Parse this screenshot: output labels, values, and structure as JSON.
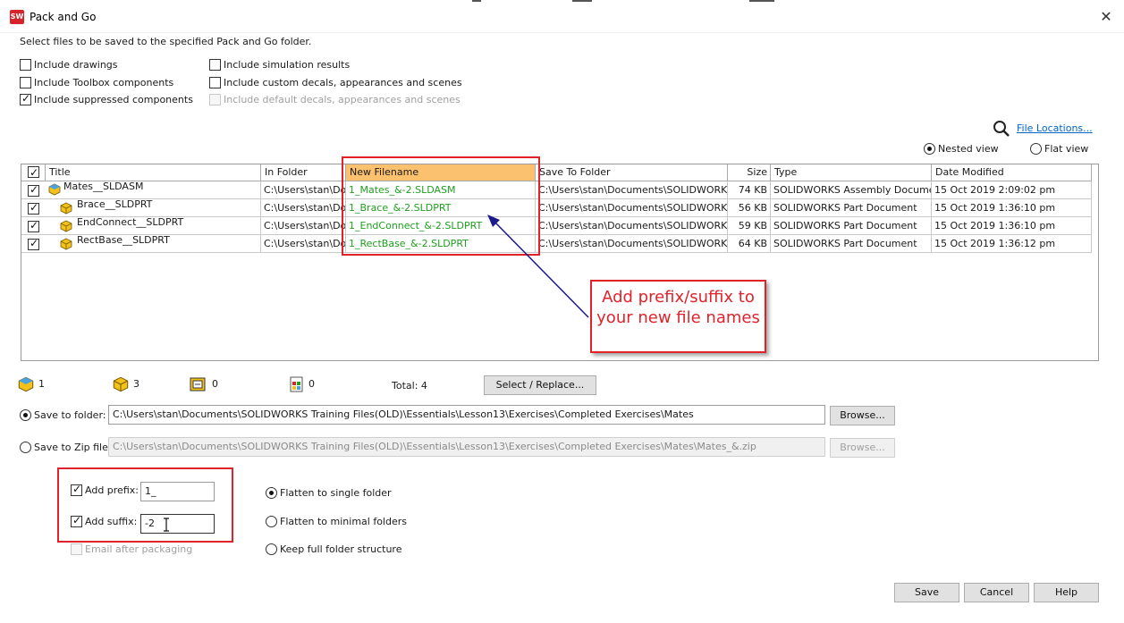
{
  "window": {
    "title": "Pack and Go",
    "app_icon_text": "SW",
    "close_glyph": "✕"
  },
  "instructions": "Select files to be saved to the specified Pack and Go folder.",
  "options_left": [
    {
      "label": "Include drawings",
      "checked": false,
      "disabled": false
    },
    {
      "label": "Include Toolbox components",
      "checked": false,
      "disabled": false
    },
    {
      "label": "Include suppressed components",
      "checked": true,
      "disabled": false
    }
  ],
  "options_right": [
    {
      "label": "Include simulation results",
      "checked": false,
      "disabled": false
    },
    {
      "label": "Include custom decals, appearances and scenes",
      "checked": false,
      "disabled": false
    },
    {
      "label": "Include default decals, appearances and scenes",
      "checked": false,
      "disabled": true
    }
  ],
  "file_locations_link": "File Locations...",
  "view_mode": {
    "nested": "Nested view",
    "flat": "Flat view",
    "selected": "nested"
  },
  "table": {
    "columns": [
      "Title",
      "In Folder",
      "New Filename",
      "Save To Folder",
      "Size",
      "Type",
      "Date Modified"
    ],
    "rows": [
      {
        "checked": true,
        "title": "Mates__SLDASM",
        "kind": "assembly",
        "in_folder": "C:\\Users\\stan\\Doc",
        "new_filename": "1_Mates_&-2.SLDASM",
        "save_to": "C:\\Users\\stan\\Documents\\SOLIDWORKS T",
        "size": "74 KB",
        "type": "SOLIDWORKS Assembly Document",
        "date": "15 Oct 2019 2:09:02 pm"
      },
      {
        "checked": true,
        "title": "Brace__SLDPRT",
        "kind": "part",
        "in_folder": "C:\\Users\\stan\\Doc",
        "new_filename": "1_Brace_&-2.SLDPRT",
        "save_to": "C:\\Users\\stan\\Documents\\SOLIDWORKS T",
        "size": "56 KB",
        "type": "SOLIDWORKS Part Document",
        "date": "15 Oct 2019 1:36:10 pm"
      },
      {
        "checked": true,
        "title": "EndConnect__SLDPRT",
        "kind": "part",
        "in_folder": "C:\\Users\\stan\\Doc",
        "new_filename": "1_EndConnect_&-2.SLDPRT",
        "save_to": "C:\\Users\\stan\\Documents\\SOLIDWORKS T",
        "size": "59 KB",
        "type": "SOLIDWORKS Part Document",
        "date": "15 Oct 2019 1:36:10 pm"
      },
      {
        "checked": true,
        "title": "RectBase__SLDPRT",
        "kind": "part",
        "in_folder": "C:\\Users\\stan\\Doc",
        "new_filename": "1_RectBase_&-2.SLDPRT",
        "save_to": "C:\\Users\\stan\\Documents\\SOLIDWORKS T",
        "size": "64 KB",
        "type": "SOLIDWORKS Part Document",
        "date": "15 Oct 2019 1:36:12 pm"
      }
    ]
  },
  "callout": {
    "line1": "Add prefix/suffix to",
    "line2": "your new file names"
  },
  "counts": {
    "assemblies": "1",
    "parts": "3",
    "drawings": "0",
    "other": "0",
    "total": "Total: 4"
  },
  "select_replace_button": "Select / Replace...",
  "save_to_folder": {
    "label": "Save to folder:",
    "value": "C:\\Users\\stan\\Documents\\SOLIDWORKS Training Files(OLD)\\Essentials\\Lesson13\\Exercises\\Completed Exercises\\Mates",
    "browse": "Browse...",
    "selected": true
  },
  "save_to_zip": {
    "label": "Save to Zip file:",
    "value": "C:\\Users\\stan\\Documents\\SOLIDWORKS Training Files(OLD)\\Essentials\\Lesson13\\Exercises\\Completed Exercises\\Mates\\Mates_&.zip",
    "browse": "Browse...",
    "selected": false
  },
  "prefix": {
    "label": "Add prefix:",
    "value": "1_",
    "checked": true
  },
  "suffix": {
    "label": "Add suffix:",
    "value": "-2",
    "checked": true
  },
  "email": {
    "label": "Email after packaging",
    "checked": false,
    "disabled": true
  },
  "structure": {
    "options": [
      "Flatten to single folder",
      "Flatten to minimal folders",
      "Keep full folder structure"
    ],
    "selected": 0
  },
  "footer_buttons": {
    "save": "Save",
    "cancel": "Cancel",
    "help": "Help"
  },
  "colors": {
    "accent_red": "#e0232b",
    "new_filename_green": "#1ea01e",
    "header_highlight": "#fcc16f",
    "link_blue": "#0066cc",
    "arrow_navy": "#1a1a8c"
  }
}
